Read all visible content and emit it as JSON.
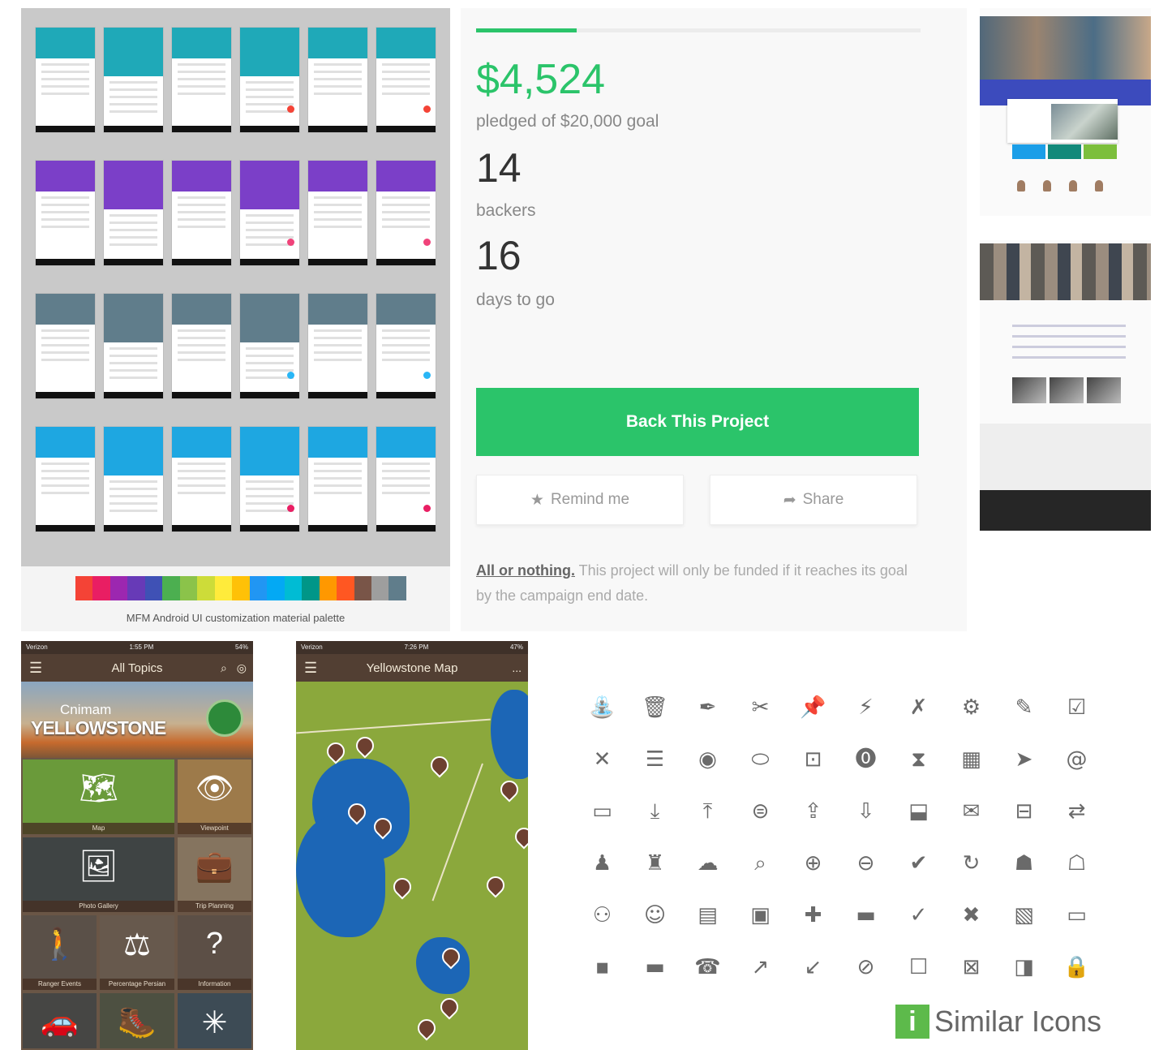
{
  "android": {
    "caption": "MFM Android UI customization material palette",
    "rows": [
      "#1fa9b8",
      "#7b3fc8",
      "#607d8b",
      "#1ea7e1"
    ],
    "fabs": [
      "#f44336",
      "#f0437a",
      "#29b6f6",
      "#e91e63"
    ],
    "palette": [
      "#f44336",
      "#e91e63",
      "#9c27b0",
      "#673ab7",
      "#3f51b5",
      "#4caf50",
      "#8bc34a",
      "#cddc39",
      "#ffeb3b",
      "#ffc107",
      "#2196f3",
      "#03a9f4",
      "#00bcd4",
      "#009688",
      "#ff9800",
      "#ff5722",
      "#795548",
      "#9e9e9e",
      "#607d8b"
    ]
  },
  "crowd": {
    "progress": 0.226,
    "amount": "$4,524",
    "pledged_label": "pledged of $20,000 goal",
    "backers": "14",
    "backers_label": "backers",
    "days": "16",
    "days_label": "days to go",
    "back_button": "Back This Project",
    "remind_button": "Remind me",
    "share_button": "Share",
    "note_strong": "All or nothing.",
    "note_text": " This project will only be funded if it reaches its goal by the campaign end date.",
    "colors": {
      "accent": "#2bc46a"
    }
  },
  "website": {
    "tile_colors": [
      "#1b9ee8",
      "#12897a",
      "#7cbf3c"
    ]
  },
  "yellowstone": {
    "status_left": "Verizon",
    "status_time": "1:55 PM",
    "status_right": "54%",
    "title": "All Topics",
    "banner_small": "Cnimam",
    "banner_big": "YELLOWSTONE",
    "cells": [
      {
        "icon": "map-icon",
        "glyph": "🗺",
        "caption": "Map"
      },
      {
        "icon": "eye-icon",
        "glyph": "👁",
        "caption": "Viewpoint"
      },
      {
        "icon": "photo-icon",
        "glyph": "🖼",
        "caption": "Photo Gallery"
      },
      {
        "icon": "suitcase-icon",
        "glyph": "💼",
        "caption": "Trip Planning"
      },
      {
        "icon": "ranger-icon",
        "glyph": "🚶",
        "caption": "Ranger Events"
      },
      {
        "icon": "weight-icon",
        "glyph": "⚖",
        "caption": "Percentage Persian"
      },
      {
        "icon": "help-icon",
        "glyph": "?",
        "caption": "Information"
      },
      {
        "icon": "car-icon",
        "glyph": "🚗",
        "caption": ""
      },
      {
        "icon": "hiker-icon",
        "glyph": "🥾",
        "caption": ""
      },
      {
        "icon": "sparkle-icon",
        "glyph": "✳",
        "caption": ""
      }
    ]
  },
  "map": {
    "status_left": "Verizon",
    "status_time": "7:26 PM",
    "status_right": "47%",
    "title": "Yellowstone Map",
    "more": "..."
  },
  "icons": {
    "glyphs": [
      "⛲",
      "🗑",
      "✒",
      "✂",
      "📌",
      "⚡",
      "✗",
      "⚙",
      "✎",
      "☑",
      "✕",
      "☰",
      "◉",
      "⬭",
      "⊡",
      "⓿",
      "⧗",
      "▦",
      "➤",
      "@",
      "▭",
      "⤓",
      "⤒",
      "⊜",
      "⇪",
      "⇩",
      "⬓",
      "✉",
      "⊟",
      "⇄",
      "♟",
      "♜",
      "☁",
      "⌕",
      "⊕",
      "⊖",
      "✔",
      "↻",
      "☗",
      "☖",
      "⚇",
      "☺",
      "▤",
      "▣",
      "✚",
      "▬",
      "✓",
      "✖",
      "▧",
      "▭",
      "▪",
      "▬",
      "☎",
      "↗",
      "↙",
      "⊘",
      "☐",
      "⊠",
      "◨",
      "🔒"
    ],
    "brand_mark": "i",
    "brand_text": "Similar Icons",
    "colors": {
      "icon": "#6a6a6a",
      "brand": "#5dba4b"
    }
  }
}
